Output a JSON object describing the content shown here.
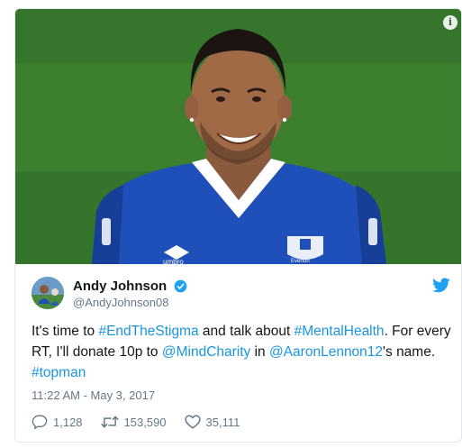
{
  "media": {
    "info_icon": "info-icon",
    "info_glyph": "i",
    "shirt_logo_text": "umbro",
    "crest_text": "Everton"
  },
  "user": {
    "name": "Andy Johnson",
    "handle": "@AndyJohnson08",
    "verified": true
  },
  "tweet": {
    "part1": "It's time to ",
    "hashtag1": "#EndTheStigma",
    "part2": " and talk about ",
    "hashtag2": "#MentalHealth",
    "part3": ". For every RT, I'll donate 10p to ",
    "mention1": "@MindCharity",
    "part4": " in ",
    "mention2": "@AaronLennon12",
    "part5": "'s name. ",
    "hashtag3": "#topman"
  },
  "timestamp": "11:22 AM - May 3, 2017",
  "actions": {
    "replies": "1,128",
    "retweets": "153,590",
    "likes": "35,111"
  },
  "colors": {
    "link": "#1b95e0",
    "muted": "#657786",
    "verified": "#1da1f2",
    "jersey": "#1f4fb8"
  }
}
